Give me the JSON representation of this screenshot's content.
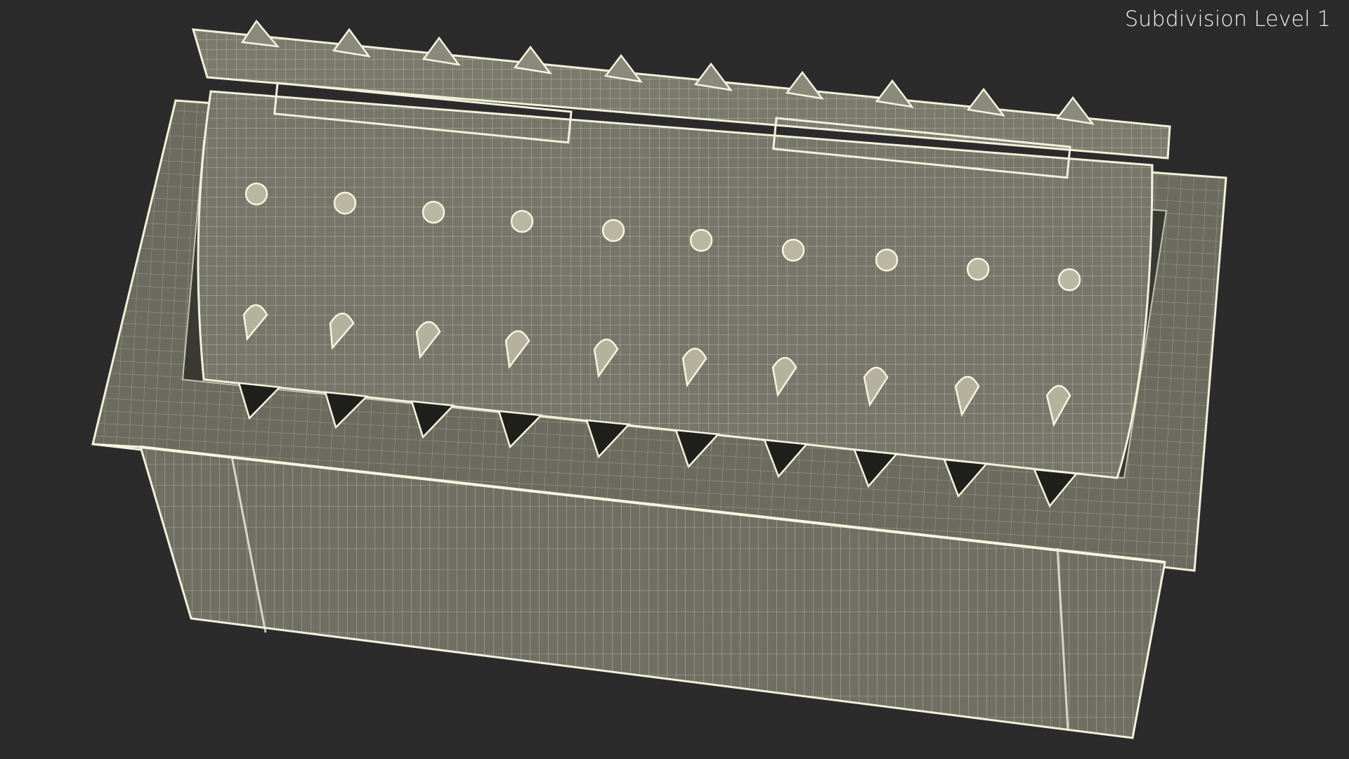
{
  "viewport": {
    "subdivision_label": "Subdivision Level 1"
  },
  "model": {
    "spike_count": 10
  }
}
